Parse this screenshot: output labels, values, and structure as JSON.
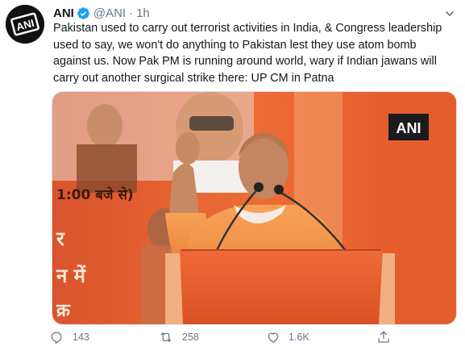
{
  "tweet": {
    "author_name": "ANI",
    "handle": "@ANI",
    "separator": "·",
    "time": "1h",
    "avatar_text": "ANI",
    "text": "Pakistan used to carry out terrorist activities in India, & Congress leadership used to say, we won't do anything to Pakistan lest they use atom bomb against us. Now Pak PM is running around world, wary if Indian jawans will carry out another surgical strike there: UP CM in Patna"
  },
  "media": {
    "watermark": "ANI",
    "backdrop_text": "1:00 बजे से)",
    "backdrop_text_2": "र",
    "backdrop_text_3": "न में",
    "backdrop_text_4": "क्र"
  },
  "actions": {
    "reply_count": "143",
    "retweet_count": "258",
    "like_count": "1.6K"
  },
  "colors": {
    "verified": "#1da1f2",
    "muted": "#657786",
    "backdrop": "#e8552a",
    "robe": "#f08a3c"
  },
  "icons": [
    "verified-icon",
    "chevron-down-icon",
    "reply-icon",
    "retweet-icon",
    "like-icon",
    "share-icon"
  ]
}
